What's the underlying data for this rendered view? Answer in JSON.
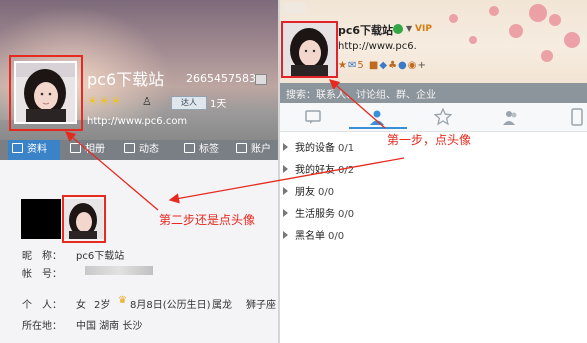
{
  "left_profile": {
    "name": "pc6下载站",
    "qq_number": "2665457583",
    "suns": "☀☀☀",
    "level_badge": "达人",
    "days": "1天",
    "url": "http://www.pc6.com",
    "tabs": [
      "资料",
      "相册",
      "动态",
      "标签",
      "账户"
    ],
    "fields": {
      "nickname_label": "昵　称：",
      "nickname": "pc6下载站",
      "account_label": "帐　号：",
      "personal_label": "个　人：",
      "gender": "女",
      "age": "2岁",
      "birthday": "8月8日(公历生日)",
      "zodiac_cn": "属龙",
      "zodiac": "狮子座",
      "location_label": "所在地：",
      "location": "中国 湖南 长沙"
    }
  },
  "right_panel": {
    "name": "pc6下载站",
    "vip": "VIP",
    "url": "http://www.pc6.",
    "status_count": "5",
    "search_text": "搜索：联系人、讨论组、群、企业",
    "groups": [
      {
        "name": "我的设备",
        "count": "0/1"
      },
      {
        "name": "我的好友",
        "count": "0/2"
      },
      {
        "name": "朋友",
        "count": "0/0"
      },
      {
        "name": "生活服务",
        "count": "0/0"
      },
      {
        "name": "黑名单",
        "count": "0/0"
      }
    ]
  },
  "annotations": {
    "step1": "第一步，点头像",
    "step2": "第二步还是点头像"
  },
  "colors": {
    "annotation_red": "#e62a1f",
    "tab_active_blue": "#3a83c9",
    "online_green": "#33a744"
  }
}
